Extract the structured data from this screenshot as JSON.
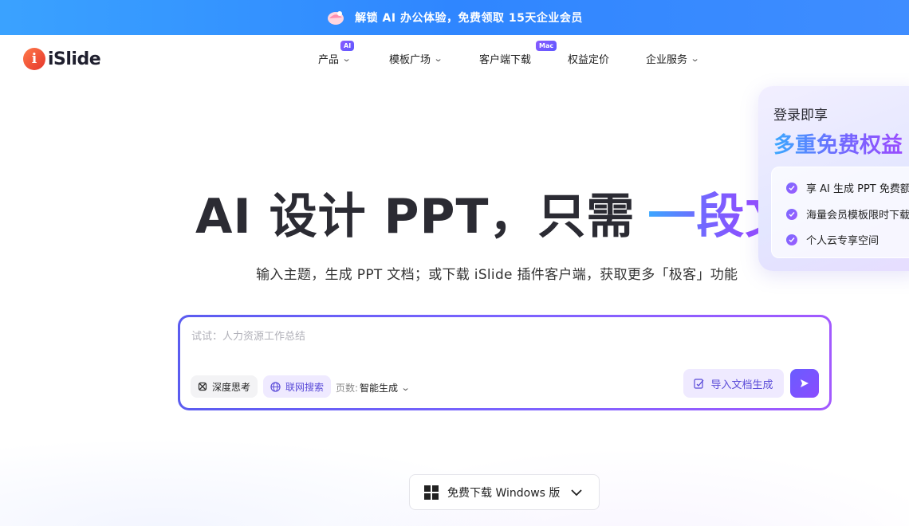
{
  "banner": {
    "text": "解锁 AI 办公体验，免费领取 15天企业会员"
  },
  "nav": {
    "logo_text": "iSlide",
    "items": [
      {
        "label": "产品",
        "badge": "AI"
      },
      {
        "label": "模板广场"
      },
      {
        "label": "客户端下载",
        "badge": "Mac"
      },
      {
        "label": "权益定价"
      },
      {
        "label": "企业服务"
      }
    ]
  },
  "hero": {
    "headline_main": "AI 设计 PPT，只需",
    "headline_highlight": "一段文",
    "subtitle": "输入主题，生成 PPT 文档；或下载 iSlide 插件客户端，获取更多「极客」功能"
  },
  "prompt": {
    "placeholder": "试试：人力资源工作总结",
    "value": "",
    "deep_think_label": "深度思考",
    "web_search_label": "联网搜索",
    "pages_label": "页数:",
    "pages_value": "智能生成",
    "import_label": "导入文档生成"
  },
  "download": {
    "label": "免费下载 Windows 版"
  },
  "promo": {
    "title": "登录即享",
    "headline": "多重免费权益",
    "benefits": [
      "享 AI 生成 PPT 免费额度",
      "海量会员模板限时下载",
      "个人云专享空间"
    ]
  },
  "colors": {
    "banner": "#2f86ff",
    "accent_purple": "#7a63ff",
    "accent_blue": "#3aa8ff"
  }
}
